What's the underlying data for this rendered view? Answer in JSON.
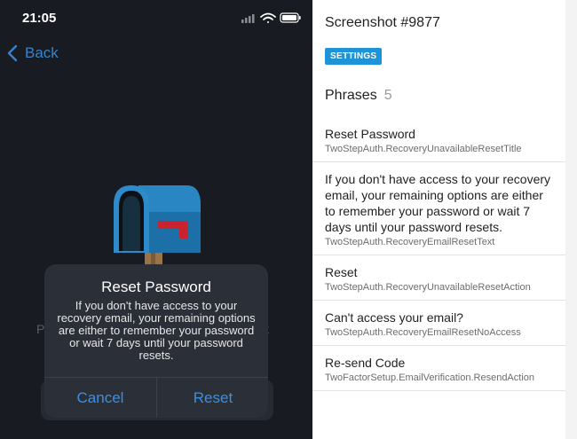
{
  "status_bar": {
    "time": "21:05"
  },
  "nav": {
    "back_label": "Back"
  },
  "background": {
    "left_text": "P",
    "right_text": "t"
  },
  "alert": {
    "title": "Reset Password",
    "body": "If you don't have access to your recovery email, your remaining options are either to remember your password or wait 7 days until your password resets.",
    "cancel_label": "Cancel",
    "reset_label": "Reset"
  },
  "panel": {
    "screenshot_title": "Screenshot #9877",
    "tag": "SETTINGS",
    "phrases_label": "Phrases",
    "phrases_count": "5",
    "phrases": [
      {
        "text": "Reset Password",
        "key": "TwoStepAuth.RecoveryUnavailableResetTitle"
      },
      {
        "text": "If you don't have access to your recovery email, your remaining options are either to remember your password or wait 7 days until your password resets.",
        "key": "TwoStepAuth.RecoveryEmailResetText"
      },
      {
        "text": "Reset",
        "key": "TwoStepAuth.RecoveryUnavailableResetAction"
      },
      {
        "text": "Can't access your email?",
        "key": "TwoStepAuth.RecoveryEmailResetNoAccess"
      },
      {
        "text": "Re-send Code",
        "key": "TwoFactorSetup.EmailVerification.ResendAction"
      }
    ]
  },
  "colors": {
    "accent": "#3a8fe4",
    "tag_bg": "#1f93d8",
    "phone_bg": "#181b21",
    "alert_bg": "#2b3038"
  }
}
